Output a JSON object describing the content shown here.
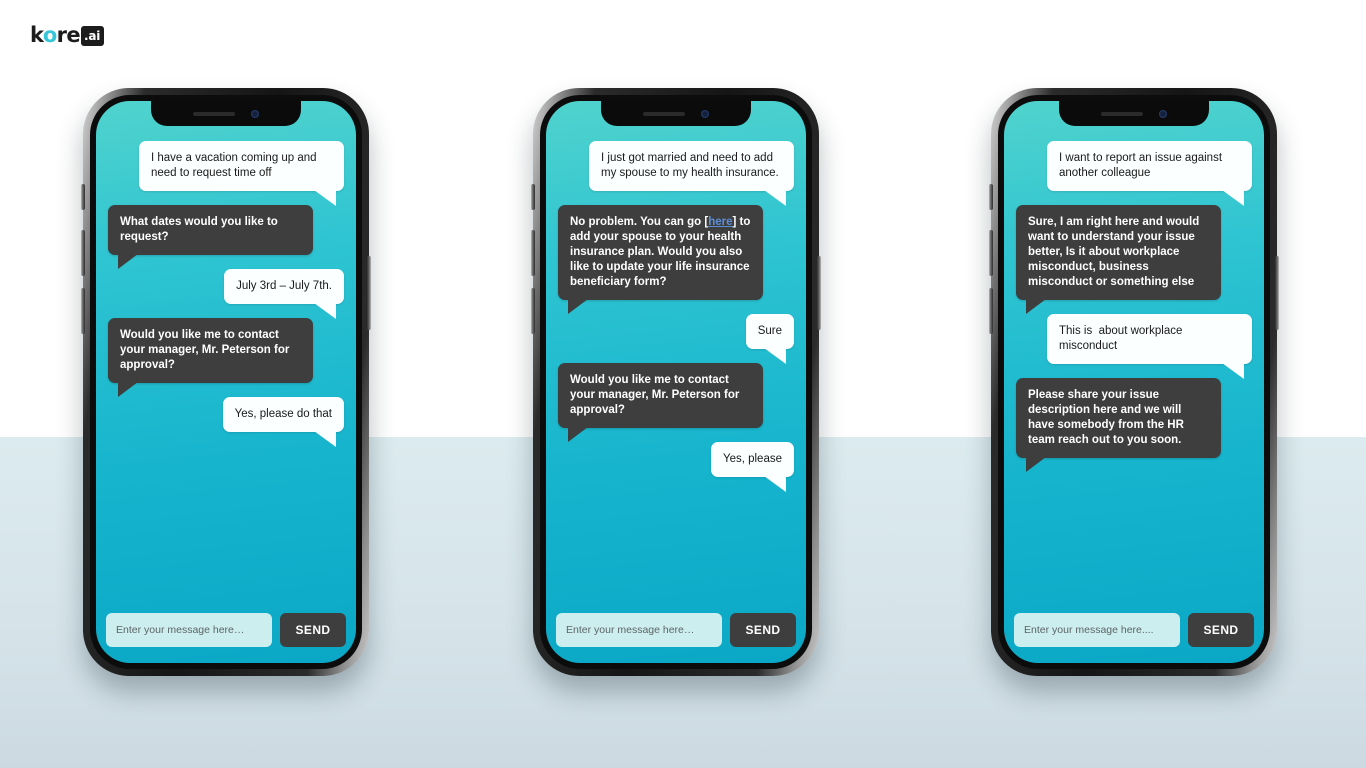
{
  "brand": {
    "name": "kore",
    "letter_o": "o",
    "word_pre": "k",
    "word_post": "re",
    "badge": ".ai",
    "accent_color": "#37c6d9"
  },
  "theme": {
    "screen_gradient_top": "#50d3cd",
    "screen_gradient_bottom": "#0aa8c6",
    "bot_bubble_color": "#3e3e3e",
    "user_bubble_color": "#fbffff",
    "input_background": "#cdeeee",
    "link_color": "#5c8ed6",
    "page_background_top": "#ffffff",
    "page_background_bottom": "#d6e4ea"
  },
  "phones": [
    {
      "id": "phone-leave-request",
      "composer": {
        "placeholder": "Enter your message here…",
        "value": "",
        "send_label": "SEND"
      },
      "messages": [
        {
          "from": "user",
          "text": "I have a vacation coming up and need to request time off"
        },
        {
          "from": "bot",
          "text": "What dates would you like to request?"
        },
        {
          "from": "user",
          "text": "July 3rd – July 7th."
        },
        {
          "from": "bot",
          "text": "Would you like me to contact your manager, Mr. Peterson for approval?"
        },
        {
          "from": "user",
          "text": "Yes, please do that"
        }
      ]
    },
    {
      "id": "phone-health-insurance",
      "composer": {
        "placeholder": "Enter your message here…",
        "value": "",
        "send_label": "SEND"
      },
      "messages": [
        {
          "from": "user",
          "text": "I just got married and need to add my spouse to my health insurance."
        },
        {
          "from": "bot",
          "text_before_link": "No problem. You can go [",
          "link_text": "here",
          "text_after_link": "] to add your spouse to your health insurance plan. Would you also like to update your life insurance beneficiary form?"
        },
        {
          "from": "user",
          "text": "Sure"
        },
        {
          "from": "bot",
          "text": "Would you like me to contact your manager, Mr. Peterson for approval?"
        },
        {
          "from": "user",
          "text": "Yes, please"
        }
      ]
    },
    {
      "id": "phone-hr-issue",
      "composer": {
        "placeholder": "Enter your message here....",
        "value": "",
        "send_label": "SEND"
      },
      "messages": [
        {
          "from": "user",
          "text": "I want to report an issue against another colleague"
        },
        {
          "from": "bot",
          "text": "Sure, I am right here and would want to understand your issue better, Is it about workplace misconduct, business misconduct or something else"
        },
        {
          "from": "user",
          "text": "This is  about workplace misconduct"
        },
        {
          "from": "bot",
          "text": "Please share your issue description here and we will have somebody from the HR team reach out to you soon."
        }
      ]
    }
  ]
}
